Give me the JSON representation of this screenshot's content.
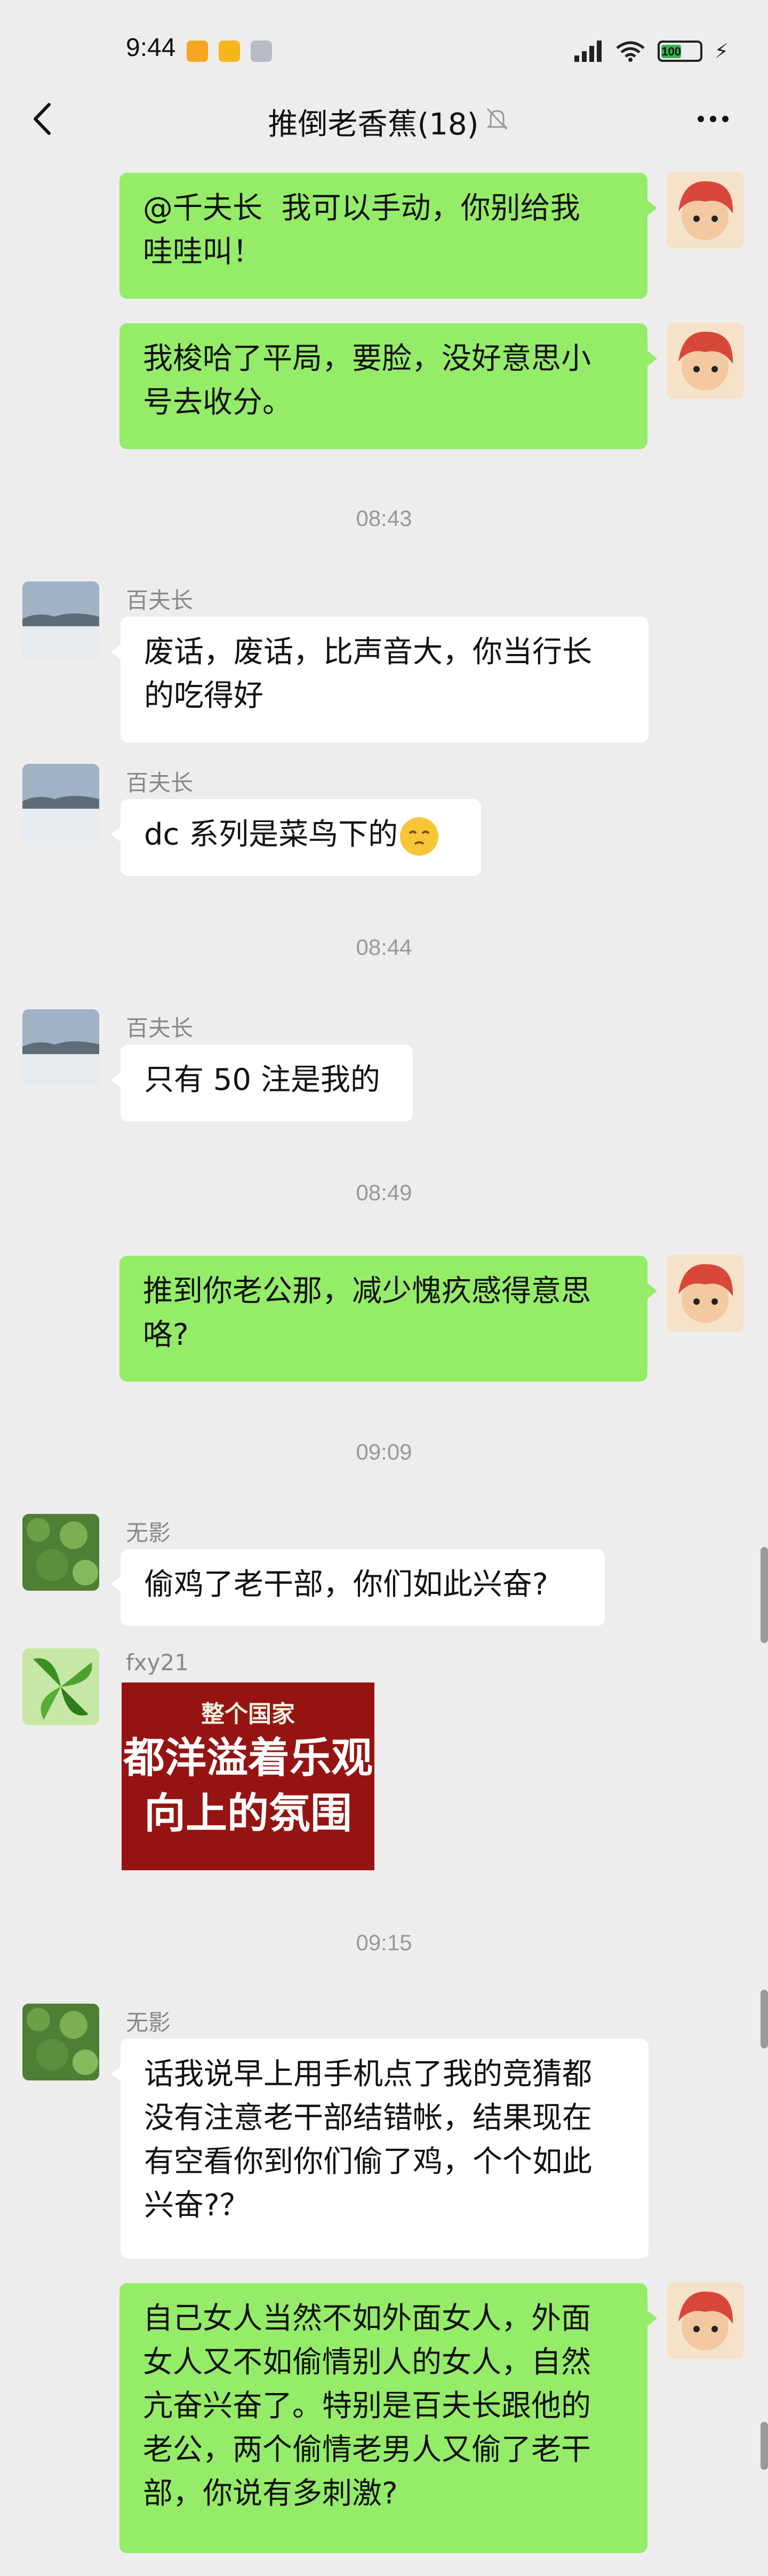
{
  "status_bar": {
    "time": "9:44",
    "battery": "100",
    "icons": [
      "photos-app-icon",
      "cloud-app-icon",
      "notification-icon"
    ]
  },
  "nav": {
    "title": "推倒老香蕉(18)",
    "back_icon": "chevron-left-icon",
    "mute_icon": "bell-muted-icon",
    "more_icon": "more-dots-icon"
  },
  "messages": [
    {
      "side": "out",
      "text": "@千夫长  我可以手动，你别给我\n哇哇叫！"
    },
    {
      "side": "out",
      "text": "我梭哈了平局，要脸，没好意思小\n号去收分。"
    },
    {
      "type": "time",
      "text": "08:43"
    },
    {
      "side": "in",
      "sender": "百夫长",
      "text": "废话，废话，比声音大，你当行长\n的吃得好"
    },
    {
      "side": "in",
      "sender": "百夫长",
      "text": "dc 系列是菜鸟下的",
      "emoji": "relieved-face-emoji"
    },
    {
      "type": "time",
      "text": "08:44"
    },
    {
      "side": "in",
      "sender": "百夫长",
      "text": "只有 50 注是我的"
    },
    {
      "type": "time",
      "text": "08:49"
    },
    {
      "side": "out",
      "text": "推到你老公那，减少愧疚感得意思\n咯?"
    },
    {
      "type": "time",
      "text": "09:09"
    },
    {
      "side": "in",
      "sender": "无影",
      "text": "偷鸡了老干部，你们如此兴奋?"
    },
    {
      "side": "in",
      "sender": "fxy21",
      "sticker": {
        "line1": "整个国家",
        "line2": "都洋溢着乐观",
        "line3": "向上的氛围"
      }
    },
    {
      "type": "time",
      "text": "09:15"
    },
    {
      "side": "in",
      "sender": "无影",
      "text": "话我说早上用手机点了我的竞猜都\n没有注意老干部结错帐，结果现在\n有空看你到你们偷了鸡，个个如此\n兴奋?？"
    },
    {
      "side": "out",
      "text": "自己女人当然不如外面女人，外面\n女人又不如偷情别人的女人，自然\n亢奋兴奋了。特别是百夫长跟他的\n老公，两个偷情老男人又偷了老干\n部，你说有多刺激?"
    }
  ],
  "colors": {
    "background": "#ededed",
    "bubble_out": "#95ec69",
    "bubble_in": "#ffffff",
    "timestamp": "#999999",
    "sticker_bg": "#951411"
  }
}
